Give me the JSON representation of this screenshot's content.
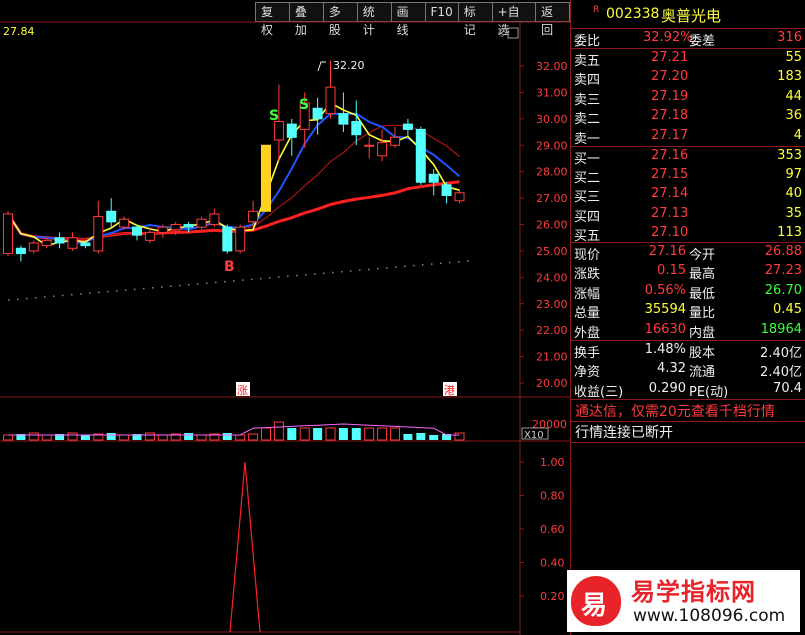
{
  "toolbar": {
    "buttons": [
      "复权",
      "叠加",
      "多股",
      "统计",
      "画线",
      "F10",
      "标记",
      "+自选",
      "返回"
    ]
  },
  "chart": {
    "current_price_label": "27.84",
    "high_label": "32.20",
    "y_ticks": [
      "32.00",
      "31.00",
      "30.00",
      "29.00",
      "28.00",
      "27.00",
      "26.00",
      "25.00",
      "24.00",
      "23.00",
      "22.00",
      "21.00",
      "20.00"
    ],
    "markers": {
      "b": "B",
      "s1": "S",
      "s2": "S",
      "zhang": "涨",
      "gang": "港"
    },
    "volume_label": "20000",
    "volume_unit": "X10",
    "indicator_ticks": [
      "1.00",
      "0.80",
      "0.60",
      "0.40",
      "0.20"
    ]
  },
  "chart_data": {
    "type": "candlestick",
    "ylim": [
      19.6,
      33.0
    ],
    "candles": [
      {
        "o": 24.9,
        "c": 26.4,
        "h": 26.5,
        "l": 24.8
      },
      {
        "o": 25.1,
        "c": 24.9,
        "h": 25.2,
        "l": 24.6
      },
      {
        "o": 25.0,
        "c": 25.3,
        "h": 25.4,
        "l": 24.9
      },
      {
        "o": 25.2,
        "c": 25.4,
        "h": 25.5,
        "l": 25.1
      },
      {
        "o": 25.5,
        "c": 25.3,
        "h": 25.7,
        "l": 25.1
      },
      {
        "o": 25.1,
        "c": 25.5,
        "h": 25.7,
        "l": 25.0
      },
      {
        "o": 25.3,
        "c": 25.2,
        "h": 25.4,
        "l": 25.1
      },
      {
        "o": 25.0,
        "c": 26.3,
        "h": 26.9,
        "l": 24.9
      },
      {
        "o": 26.5,
        "c": 26.1,
        "h": 27.0,
        "l": 25.9
      },
      {
        "o": 25.9,
        "c": 26.2,
        "h": 26.3,
        "l": 25.8
      },
      {
        "o": 25.9,
        "c": 25.6,
        "h": 26.0,
        "l": 25.4
      },
      {
        "o": 25.4,
        "c": 25.7,
        "h": 25.9,
        "l": 25.3
      },
      {
        "o": 25.7,
        "c": 25.9,
        "h": 26.0,
        "l": 25.5
      },
      {
        "o": 25.8,
        "c": 26.0,
        "h": 26.1,
        "l": 25.6
      },
      {
        "o": 26.0,
        "c": 25.9,
        "h": 26.1,
        "l": 25.7
      },
      {
        "o": 25.9,
        "c": 26.2,
        "h": 26.3,
        "l": 25.8
      },
      {
        "o": 26.0,
        "c": 26.4,
        "h": 26.6,
        "l": 25.9
      },
      {
        "o": 25.9,
        "c": 25.0,
        "h": 26.0,
        "l": 24.9
      },
      {
        "o": 25.0,
        "c": 25.9,
        "h": 26.0,
        "l": 24.9
      },
      {
        "o": 26.1,
        "c": 26.5,
        "h": 26.9,
        "l": 25.9
      },
      {
        "o": 26.5,
        "c": 29.0,
        "h": 29.0,
        "l": 26.5
      },
      {
        "o": 29.2,
        "c": 29.9,
        "h": 31.3,
        "l": 28.4
      },
      {
        "o": 29.8,
        "c": 29.3,
        "h": 30.0,
        "l": 28.6
      },
      {
        "o": 29.6,
        "c": 30.6,
        "h": 31.0,
        "l": 28.9
      },
      {
        "o": 30.4,
        "c": 30.0,
        "h": 30.8,
        "l": 29.4
      },
      {
        "o": 30.2,
        "c": 31.2,
        "h": 32.2,
        "l": 30.0
      },
      {
        "o": 30.2,
        "c": 29.8,
        "h": 31.0,
        "l": 29.5
      },
      {
        "o": 29.9,
        "c": 29.4,
        "h": 30.7,
        "l": 29.0
      },
      {
        "o": 29.0,
        "c": 29.0,
        "h": 29.3,
        "l": 28.5
      },
      {
        "o": 28.6,
        "c": 29.1,
        "h": 29.6,
        "l": 28.4
      },
      {
        "o": 29.0,
        "c": 29.3,
        "h": 29.7,
        "l": 28.9
      },
      {
        "o": 29.8,
        "c": 29.6,
        "h": 30.0,
        "l": 29.3
      },
      {
        "o": 29.6,
        "c": 27.6,
        "h": 29.7,
        "l": 27.5
      },
      {
        "o": 27.9,
        "c": 27.6,
        "h": 28.1,
        "l": 27.1
      },
      {
        "o": 27.5,
        "c": 27.1,
        "h": 27.6,
        "l": 26.8
      },
      {
        "o": 26.9,
        "c": 27.2,
        "h": 27.3,
        "l": 26.8
      }
    ]
  },
  "quote": {
    "code_prefix": "R",
    "code": "002338",
    "name": "奥普光电",
    "weibi_label": "委比",
    "weibi_value": "32.92%",
    "weicha_label": "委差",
    "weicha_value": "316",
    "asks": [
      {
        "label": "卖五",
        "price": "27.21",
        "vol": "55"
      },
      {
        "label": "卖四",
        "price": "27.20",
        "vol": "183"
      },
      {
        "label": "卖三",
        "price": "27.19",
        "vol": "44"
      },
      {
        "label": "卖二",
        "price": "27.18",
        "vol": "36"
      },
      {
        "label": "卖一",
        "price": "27.17",
        "vol": "4"
      }
    ],
    "bids": [
      {
        "label": "买一",
        "price": "27.16",
        "vol": "353"
      },
      {
        "label": "买二",
        "price": "27.15",
        "vol": "97"
      },
      {
        "label": "买三",
        "price": "27.14",
        "vol": "40"
      },
      {
        "label": "买四",
        "price": "27.13",
        "vol": "35"
      },
      {
        "label": "买五",
        "price": "27.10",
        "vol": "113"
      }
    ],
    "stats": [
      {
        "l1": "现价",
        "v1": "27.16",
        "l2": "今开",
        "v2": "26.88"
      },
      {
        "l1": "涨跌",
        "v1": "0.15",
        "l2": "最高",
        "v2": "27.23"
      },
      {
        "l1": "涨幅",
        "v1": "0.56%",
        "l2": "最低",
        "v2": "26.70"
      },
      {
        "l1": "总量",
        "v1": "35594",
        "l2": "量比",
        "v2": "0.45"
      },
      {
        "l1": "外盘",
        "v1": "16630",
        "l2": "内盘",
        "v2": "18964"
      }
    ],
    "fin": [
      {
        "l1": "换手",
        "v1": "1.48%",
        "l2": "股本",
        "v2": "2.40亿"
      },
      {
        "l1": "净资",
        "v1": "4.32",
        "l2": "流通",
        "v2": "2.40亿"
      },
      {
        "l1": "收益(三)",
        "v1": "0.290",
        "l2": "PE(动)",
        "v2": "70.4"
      }
    ],
    "notice1": "通达信，仅需20元查看千档行情",
    "notice2": "行情连接已断开"
  },
  "watermark": {
    "logo_char": "易",
    "title": "易学指标网",
    "url": "www.108096.com"
  },
  "colors": {
    "up": "#ff3b3b",
    "down": "#54ffff",
    "axis": "#8b1a1a",
    "ma_fast": "#ffff3b",
    "ma_mid": "#2255ff",
    "ma_slow": "#ff2020"
  }
}
